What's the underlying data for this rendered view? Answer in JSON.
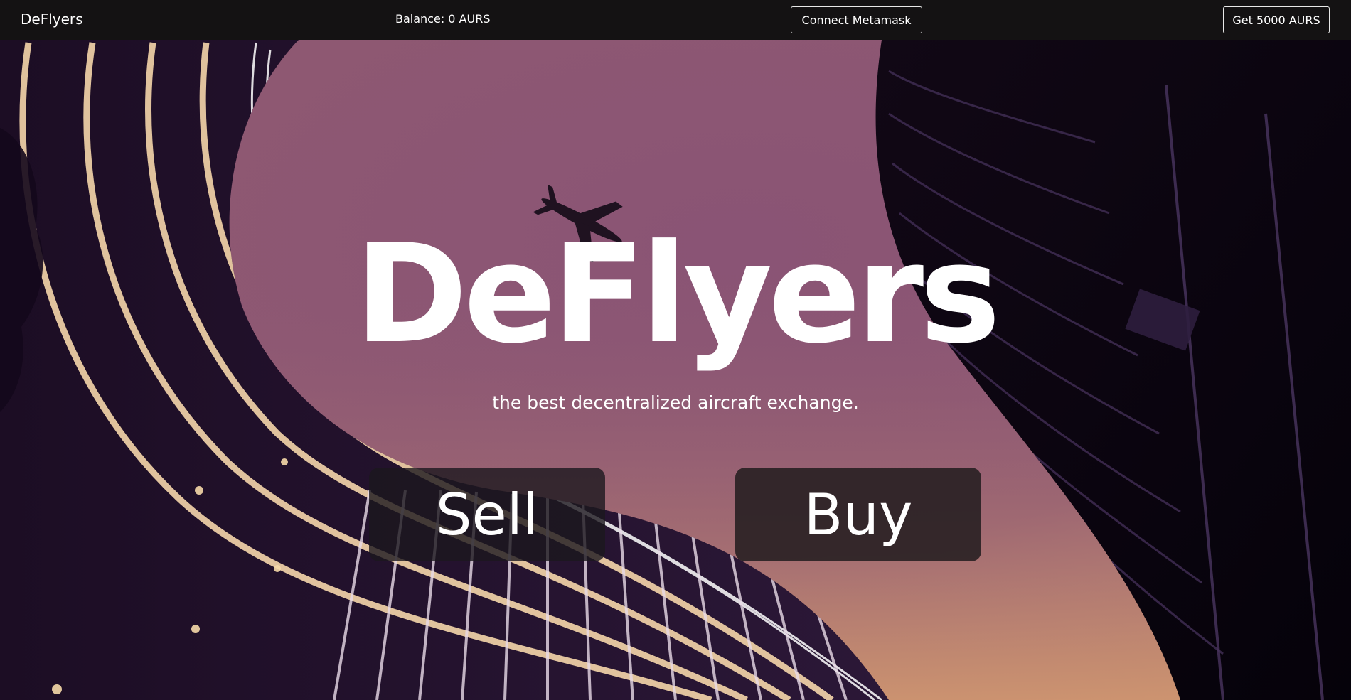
{
  "nav": {
    "brand": "DeFlyers",
    "balance": "Balance: 0 AURS",
    "connect_label": "Connect Metamask",
    "get_tokens_label": "Get 5000 AURS"
  },
  "hero": {
    "title": "DeFlyers",
    "subtitle": "the best decentralized aircraft exchange.",
    "sell_label": "Sell",
    "buy_label": "Buy"
  },
  "icons": {
    "airplane": "airplane-icon"
  },
  "colors": {
    "navbar_bg": "#141213",
    "sky_top": "#7d4f73",
    "sky_bottom": "#b87d6e",
    "building_dark": "#1a0c24",
    "button_bg": "#1e1a1c"
  }
}
